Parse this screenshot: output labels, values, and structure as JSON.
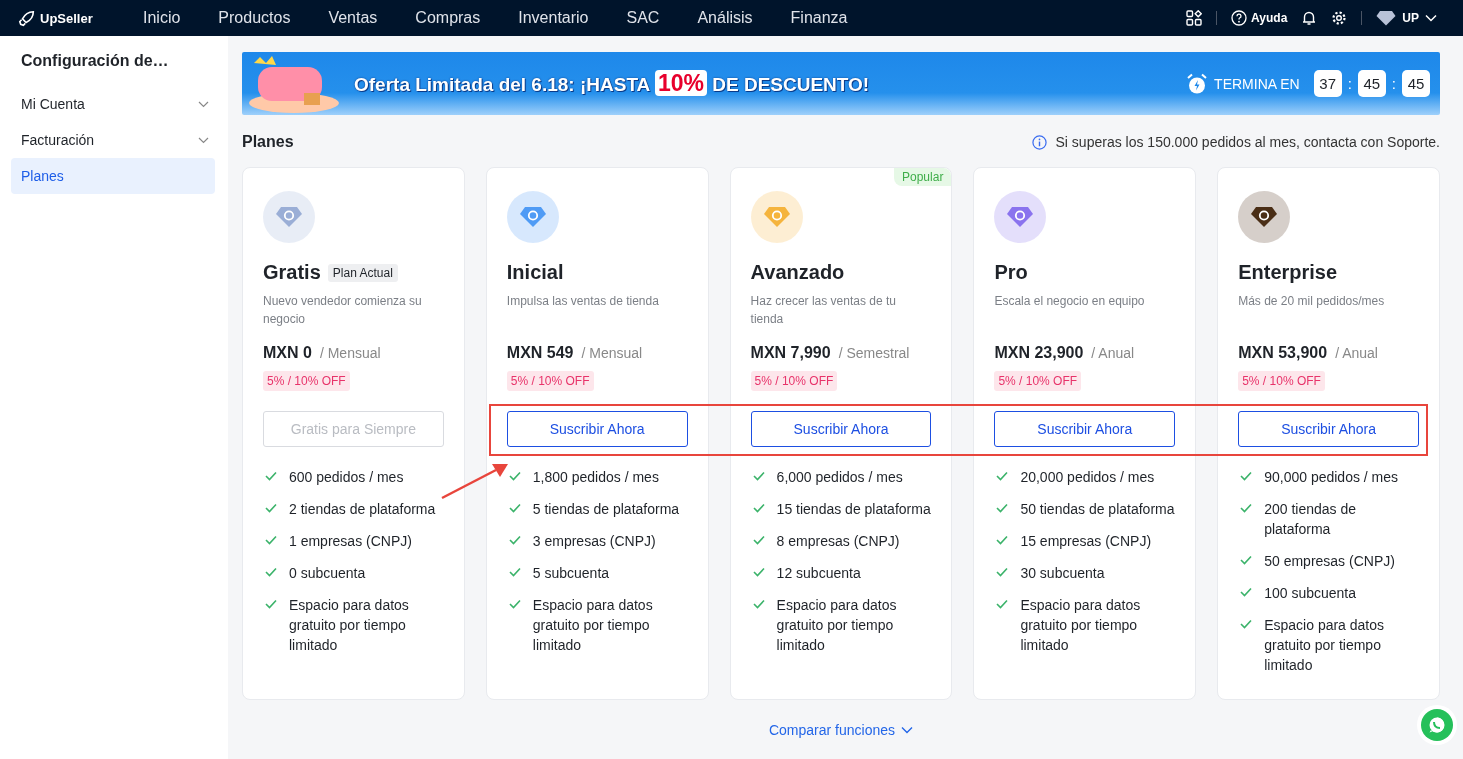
{
  "topbar": {
    "brand": "UpSeller",
    "nav": [
      {
        "label": "Inicio"
      },
      {
        "label": "Productos"
      },
      {
        "label": "Ventas"
      },
      {
        "label": "Compras"
      },
      {
        "label": "Inventario"
      },
      {
        "label": "SAC"
      },
      {
        "label": "Análisis"
      },
      {
        "label": "Finanza"
      }
    ],
    "help": "Ayuda",
    "user": "UP"
  },
  "sidebar": {
    "title": "Configuración de…",
    "items": [
      {
        "label": "Mi Cuenta",
        "kind": "group",
        "selected": false
      },
      {
        "label": "Facturación",
        "kind": "group",
        "selected": false
      },
      {
        "label": "Planes",
        "kind": "link",
        "selected": true
      }
    ]
  },
  "banner": {
    "text": "Oferta Limitada del 6.18: ¡HASTA **10%** DE DESCUENTO!",
    "timer_label": "TERMINA EN",
    "timer": [
      "37",
      "45",
      "45"
    ],
    "separator": ":"
  },
  "section": {
    "title": "Planes",
    "notice": "Si superas los 150.000 pedidos al mes, contacta con Soporte."
  },
  "plans": [
    {
      "name": "Gratis",
      "tag": "Plan Actual",
      "description": "Nuevo vendedor comienza su negocio",
      "price": "MXN 0",
      "period": "/ Mensual",
      "discount": "5% / 10% OFF",
      "button": "Gratis para Siempre",
      "disabled": true,
      "color": "#9aaed6",
      "features": [
        "600 pedidos / mes",
        "2 tiendas de plataforma",
        "1 empresas (CNPJ)",
        "0 subcuenta",
        "Espacio para datos gratuito por tiempo limitado"
      ]
    },
    {
      "name": "Inicial",
      "description": "Impulsa las ventas de tienda",
      "price": "MXN 549",
      "period": "/ Mensual",
      "discount": "5% / 10% OFF",
      "button": "Suscribir Ahora",
      "disabled": false,
      "color": "#4f9bf5",
      "features": [
        "1,800 pedidos / mes",
        "5 tiendas de plataforma",
        "3 empresas (CNPJ)",
        "5 subcuenta",
        "Espacio para datos gratuito por tiempo limitado"
      ]
    },
    {
      "name": "Avanzado",
      "badge": "Popular",
      "description": "Haz crecer las ventas de tu tienda",
      "price": "MXN 7,990",
      "period": "/ Semestral",
      "discount": "5% / 10% OFF",
      "button": "Suscribir Ahora",
      "disabled": false,
      "color": "#f5b43d",
      "features": [
        "6,000 pedidos / mes",
        "15 tiendas de plataforma",
        "8 empresas (CNPJ)",
        "12 subcuenta",
        "Espacio para datos gratuito por tiempo limitado"
      ]
    },
    {
      "name": "Pro",
      "description": "Escala el negocio en equipo",
      "price": "MXN 23,900",
      "period": "/ Anual",
      "discount": "5% / 10% OFF",
      "button": "Suscribir Ahora",
      "disabled": false,
      "color": "#8a73ee",
      "features": [
        "20,000 pedidos / mes",
        "50 tiendas de plataforma",
        "15 empresas (CNPJ)",
        "30 subcuenta",
        "Espacio para datos gratuito por tiempo limitado"
      ]
    },
    {
      "name": "Enterprise",
      "description": "Más de 20 mil pedidos/mes",
      "price": "MXN 53,900",
      "period": "/ Anual",
      "discount": "5% / 10% OFF",
      "button": "Suscribir Ahora",
      "disabled": false,
      "color": "#4a2e16",
      "features": [
        "90,000 pedidos / mes",
        "200 tiendas de plataforma",
        "50 empresas (CNPJ)",
        "100 subcuenta",
        "Espacio para datos gratuito por tiempo limitado"
      ]
    }
  ],
  "compare": "Comparar funciones"
}
